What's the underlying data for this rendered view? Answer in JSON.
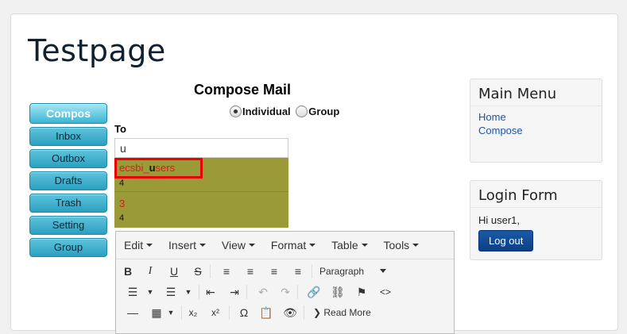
{
  "site": {
    "title": "Testpage"
  },
  "nav": {
    "items": [
      {
        "label": "Compos",
        "active": true
      },
      {
        "label": "Inbox"
      },
      {
        "label": "Outbox"
      },
      {
        "label": "Drafts"
      },
      {
        "label": "Trash"
      },
      {
        "label": "Setting"
      },
      {
        "label": "Group"
      }
    ]
  },
  "compose": {
    "title": "Compose Mail",
    "radio_individual": "Individual",
    "radio_group": "Group",
    "to_label": "To",
    "to_value": "u",
    "suggestions": [
      {
        "prefix": "ecsbi_",
        "match": "u",
        "suffix": "sers",
        "count": "4"
      },
      {
        "prefix": "3",
        "match": "",
        "suffix": "",
        "count": "4"
      }
    ]
  },
  "editor": {
    "menus": [
      "Edit",
      "Insert",
      "View",
      "Format",
      "Table",
      "Tools"
    ],
    "paragraph": "Paragraph",
    "read_more": "Read More"
  },
  "main_menu": {
    "title": "Main Menu",
    "links": [
      "Home",
      "Compose"
    ]
  },
  "login": {
    "title": "Login Form",
    "greeting": "Hi user1,",
    "logout": "Log out"
  },
  "colors": {
    "suggest_bg": "#9a9a38",
    "highlight": "#e00000",
    "nav": "#2aa0c0"
  }
}
